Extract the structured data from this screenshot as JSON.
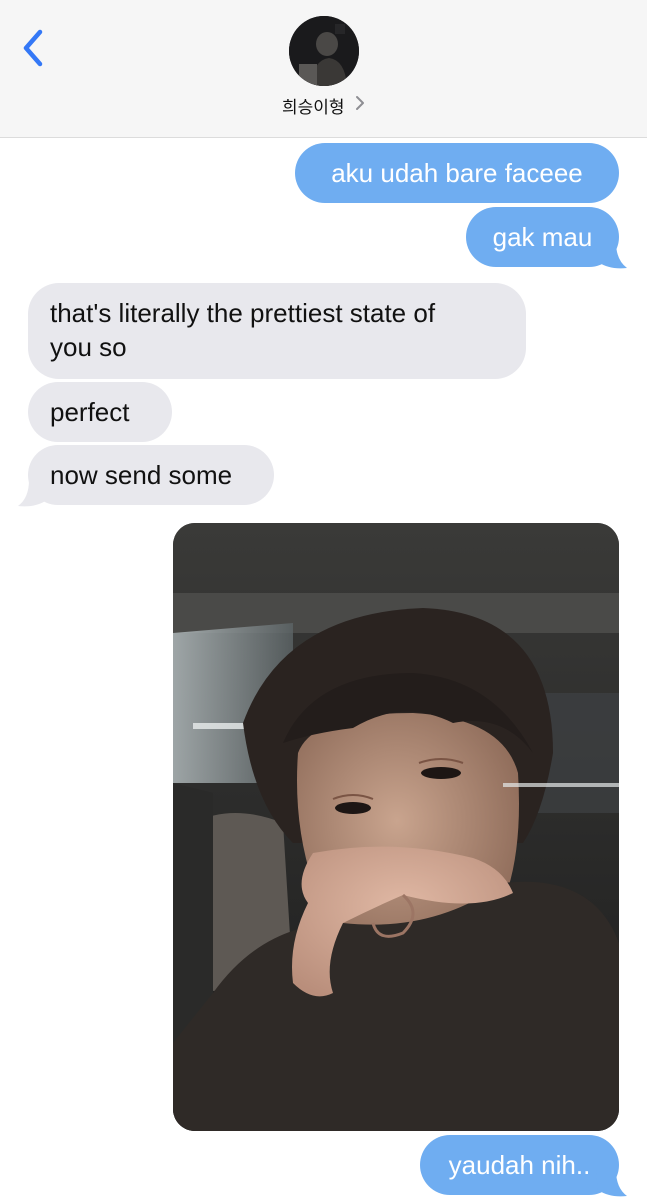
{
  "header": {
    "contact_name": "희승이형",
    "back_icon": "chevron-left-icon",
    "name_chevron_icon": "chevron-right-icon",
    "accent_color": "#3478f6"
  },
  "messages": [
    {
      "direction": "sent",
      "text": "aku udah bare faceee"
    },
    {
      "direction": "sent",
      "text": "gak mau"
    },
    {
      "direction": "received",
      "lines": [
        "that's literally the prettiest state of",
        "you so"
      ]
    },
    {
      "direction": "received",
      "text": "perfect"
    },
    {
      "direction": "received",
      "text": "now send some"
    },
    {
      "direction": "sent",
      "type": "photo"
    },
    {
      "direction": "sent",
      "text": "yaudah nih.."
    }
  ],
  "colors": {
    "sent_bubble": "#6fadf1",
    "received_bubble": "#e8e8ed",
    "header_bg": "#f6f6f6"
  }
}
